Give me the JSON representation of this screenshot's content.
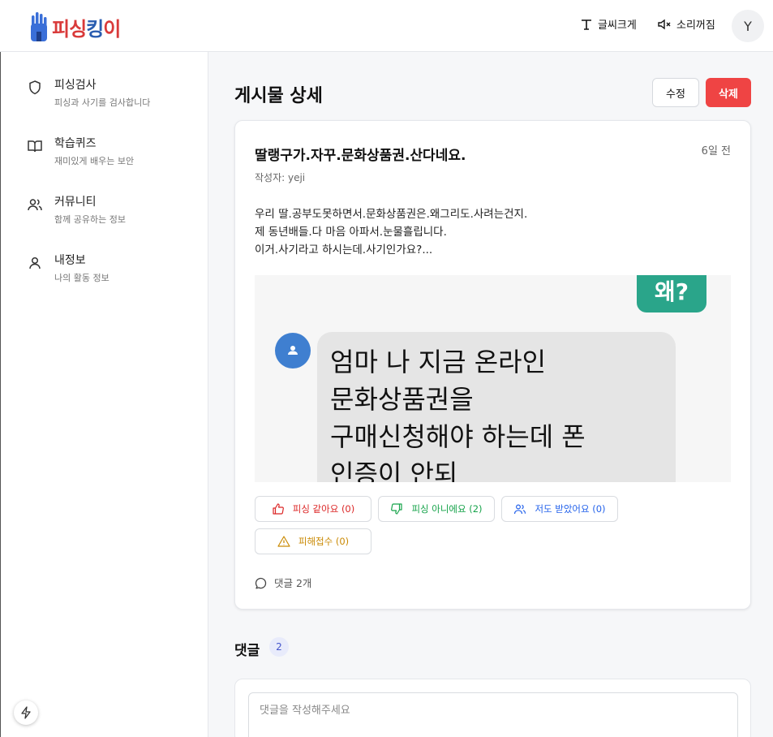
{
  "header": {
    "logo_text_a": "피싱",
    "logo_text_b": "킹",
    "logo_text_c": "이",
    "font_size_label": "글씨크게",
    "mute_label": "소리꺼짐",
    "avatar_initial": "Y"
  },
  "sidebar": {
    "items": [
      {
        "title": "피싱검사",
        "sub": "피싱과 사기를 검사합니다",
        "icon": "shield-icon"
      },
      {
        "title": "학습퀴즈",
        "sub": "재미있게 배우는 보안",
        "icon": "book-icon"
      },
      {
        "title": "커뮤니티",
        "sub": "함께 공유하는 정보",
        "icon": "users-icon"
      },
      {
        "title": "내정보",
        "sub": "나의 활동 정보",
        "icon": "user-icon"
      }
    ]
  },
  "page": {
    "title": "게시물 상세",
    "edit_label": "수정",
    "delete_label": "삭제"
  },
  "post": {
    "title": "딸랭구가.자꾸.문화상품권.산다네요.",
    "time": "6일 전",
    "author": "작성자: yeji",
    "body": [
      "우리 딸.공부도못하면서.문화상품권은.왜그리도.사려는건지.",
      "제 동년배들.다 마음 아파서.눈물흘립니다.",
      "이거.사기라고 하시는데.사기인가요?..."
    ],
    "image": {
      "teal_text": "왜?",
      "message_lines": [
        "엄마 나 지금 온라인",
        "문화상품권을",
        "구매신청해야 하는데 폰",
        "인증이 안되"
      ]
    },
    "reactions": [
      {
        "label": "피싱 같아요 (0)",
        "icon": "thumbs-up-icon",
        "color": "#dc2626"
      },
      {
        "label": "피싱 아니에요 (2)",
        "icon": "thumbs-down-icon",
        "color": "#16a34a"
      },
      {
        "label": "저도 받았어요 (0)",
        "icon": "users-icon",
        "color": "#2563eb"
      },
      {
        "label": "피해접수 (0)",
        "icon": "alert-triangle-icon",
        "color": "#ca8a04"
      }
    ],
    "comment_count_label": "댓글 2개"
  },
  "comments": {
    "title": "댓글",
    "count": "2",
    "placeholder": "댓글을 작성해주세요"
  }
}
